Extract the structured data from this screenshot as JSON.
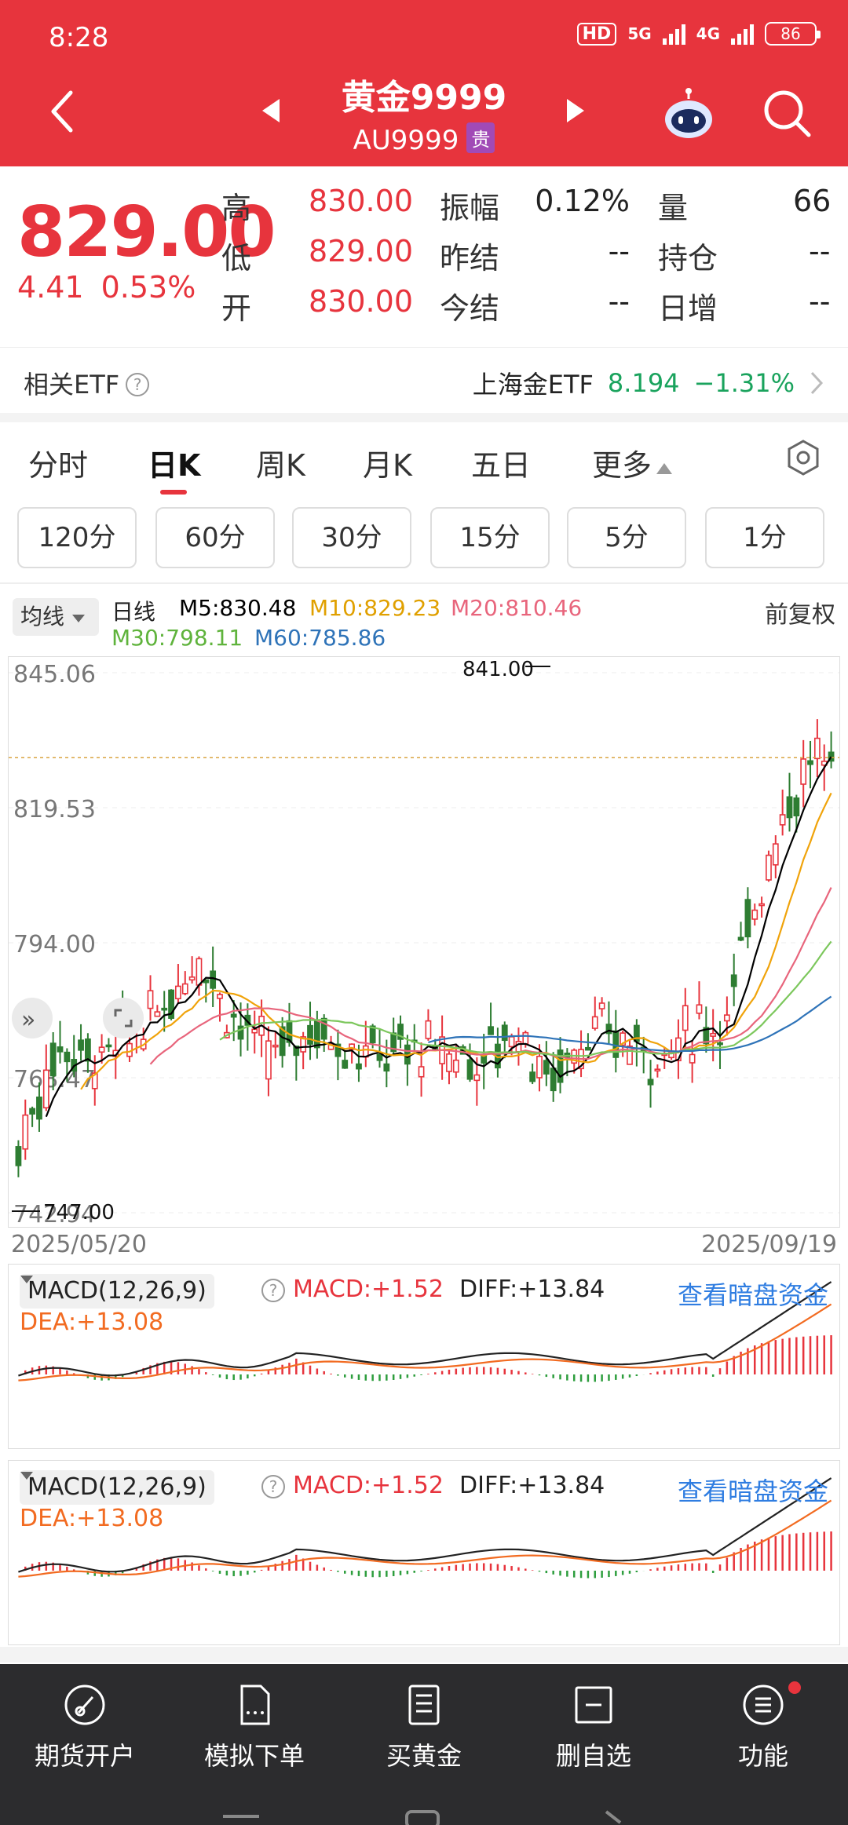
{
  "status": {
    "time": "8:28",
    "hd": "HD",
    "net1": "5G",
    "net2": "4G",
    "battery": "86"
  },
  "header": {
    "title": "黄金9999",
    "code": "AU9999",
    "badge": "贵"
  },
  "quote": {
    "price": "829.00",
    "change": "4.41",
    "change_pct": "0.53%",
    "labels": {
      "high": "高",
      "low": "低",
      "open": "开",
      "amplitude": "振幅",
      "prev_settle": "昨结",
      "settle": "今结",
      "volume": "量",
      "position": "持仓",
      "daily_inc": "日增"
    },
    "values": {
      "high": "830.00",
      "low": "829.00",
      "open": "830.00",
      "amplitude": "0.12%",
      "prev_settle": "--",
      "settle": "--",
      "volume": "66",
      "position": "--",
      "daily_inc": "--"
    }
  },
  "etf": {
    "label": "相关ETF",
    "name": "上海金ETF",
    "price": "8.194",
    "change": "−1.31%"
  },
  "tabs": {
    "items": [
      "分时",
      "日K",
      "周K",
      "月K",
      "五日",
      "更多"
    ],
    "active": "日K"
  },
  "periods": [
    "120分",
    "60分",
    "30分",
    "15分",
    "5分",
    "1分"
  ],
  "ma": {
    "select": "均线",
    "type": "日线",
    "m5": "M5:830.48",
    "m10": "M10:829.23",
    "m20": "M20:810.46",
    "m30": "M30:798.11",
    "m60": "M60:785.86",
    "adjust": "前复权",
    "colors": {
      "m5": "#000000",
      "m10": "#f0a30a",
      "m20": "#e8657c",
      "m30": "#7cc75c",
      "m60": "#2e73b8"
    }
  },
  "chart_data": {
    "type": "candlestick",
    "y_ticks": [
      "845.06",
      "819.53",
      "794.00",
      "768.47",
      "742.94"
    ],
    "ylim": [
      742.94,
      845.06
    ],
    "high_marker": "841.00",
    "low_marker": "747.00",
    "last_price": 829.0,
    "x_start": "2025/05/20",
    "x_end": "2025/09/19",
    "colors": {
      "up": "#e7343d",
      "down": "#2e7d32"
    }
  },
  "macd": {
    "label": "MACD(12,26,9)",
    "macd": "MACD:+1.52",
    "diff": "DIFF:+13.84",
    "dea": "DEA:+13.08",
    "link": "查看暗盘资金"
  },
  "nav": {
    "items": [
      {
        "label": "期货开户",
        "icon": "pen-circle-icon"
      },
      {
        "label": "模拟下单",
        "icon": "document-icon"
      },
      {
        "label": "买黄金",
        "icon": "notes-icon"
      },
      {
        "label": "删自选",
        "icon": "remove-favorite-icon"
      },
      {
        "label": "功能",
        "icon": "menu-circle-icon"
      }
    ]
  }
}
